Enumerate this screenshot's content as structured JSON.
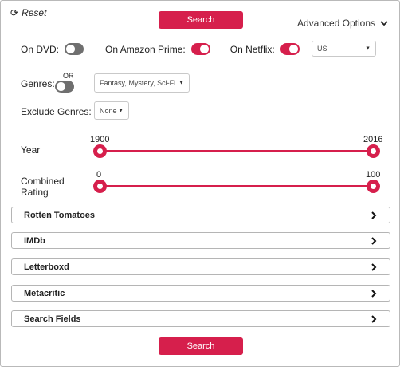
{
  "header": {
    "reset_icon": "refresh-icon",
    "reset_label": "Reset",
    "search_label": "Search",
    "advanced_label": "Advanced Options",
    "advanced_icon": "chevron-down-icon"
  },
  "availability": {
    "dvd": {
      "label": "On DVD:",
      "on": false
    },
    "amazon": {
      "label": "On Amazon Prime:",
      "on": true
    },
    "netflix": {
      "label": "On Netflix:",
      "on": true
    },
    "country": {
      "value": "US"
    }
  },
  "genres": {
    "label": "Genres:",
    "or_label": "OR",
    "or_toggle_on": false,
    "value": "Fantasy, Mystery, Sci-Fi"
  },
  "exclude": {
    "label": "Exclude Genres:",
    "value": "None"
  },
  "year": {
    "label": "Year",
    "min_label": "1900",
    "max_label": "2016",
    "range_min": 1900,
    "range_max": 2016,
    "low": 1900,
    "high": 2016
  },
  "rating": {
    "label_line1": "Combined",
    "label_line2": "Rating",
    "min_label": "0",
    "max_label": "100",
    "range_min": 0,
    "range_max": 100,
    "low": 0,
    "high": 100
  },
  "sections": [
    {
      "label": "Rotten Tomatoes"
    },
    {
      "label": "IMDb"
    },
    {
      "label": "Letterboxd"
    },
    {
      "label": "Metacritic"
    },
    {
      "label": "Search Fields"
    }
  ],
  "footer": {
    "search_label": "Search"
  },
  "colors": {
    "accent": "#d61f4c",
    "toggle_off": "#6f6f6f"
  }
}
